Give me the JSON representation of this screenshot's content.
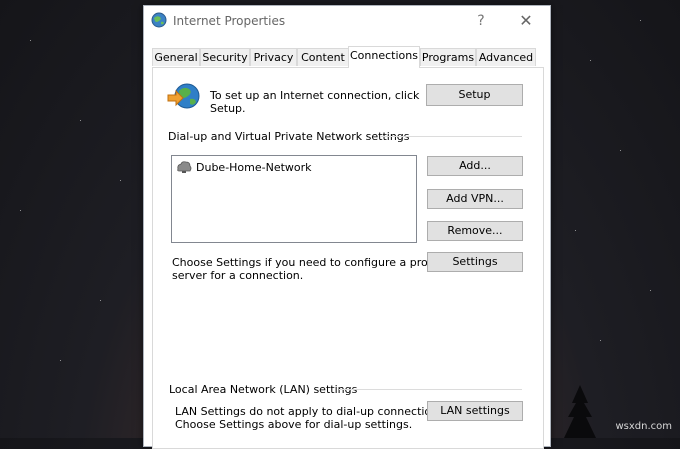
{
  "window": {
    "title": "Internet Properties",
    "help_glyph": "?",
    "close_glyph": "✕"
  },
  "tabs": [
    "General",
    "Security",
    "Privacy",
    "Content",
    "Connections",
    "Programs",
    "Advanced"
  ],
  "active_tab": "Connections",
  "setup": {
    "text_line1": "To set up an Internet connection, click",
    "text_line2": "Setup.",
    "button": "Setup"
  },
  "dialup": {
    "heading": "Dial-up and Virtual Private Network settings",
    "items": [
      "Dube-Home-Network"
    ],
    "add_button": "Add...",
    "add_vpn_button": "Add VPN...",
    "remove_button": "Remove...",
    "settings_text_line1": "Choose Settings if you need to configure a proxy",
    "settings_text_line2": "server for a connection.",
    "settings_button": "Settings"
  },
  "lan": {
    "heading": "Local Area Network (LAN) settings",
    "text_line1": "LAN Settings do not apply to dial-up connections.",
    "text_line2": "Choose Settings above for dial-up settings.",
    "button": "LAN settings"
  },
  "watermark": "wsxdn.com",
  "colors": {
    "button_face": "#e1e1e1",
    "button_border": "#adadad",
    "group_line": "#dcdcdc"
  }
}
